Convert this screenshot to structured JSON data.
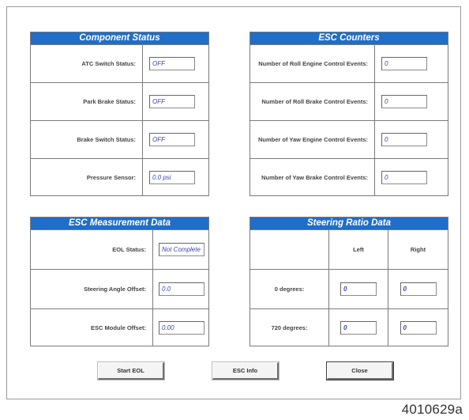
{
  "component_status": {
    "title": "Component Status",
    "rows": [
      {
        "label": "ATC Switch Status:",
        "value": "OFF"
      },
      {
        "label": "Park Brake Status:",
        "value": "OFF"
      },
      {
        "label": "Brake Switch Status:",
        "value": "OFF"
      },
      {
        "label": "Pressure Sensor:",
        "value": "0.0 psi"
      }
    ]
  },
  "esc_counters": {
    "title": "ESC Counters",
    "rows": [
      {
        "label": "Number of Roll Engine Control Events:",
        "value": "0"
      },
      {
        "label": "Number of Roll Brake Control Events:",
        "value": "0"
      },
      {
        "label": "Number of Yaw Engine Control Events:",
        "value": "0"
      },
      {
        "label": "Number of Yaw Brake Control Events:",
        "value": "0"
      }
    ]
  },
  "esc_measurement": {
    "title": "ESC Measurement Data",
    "rows": [
      {
        "label": "EOL Status:",
        "value": "Not Complete"
      },
      {
        "label": "Steering Angle Offset:",
        "value": "0.0"
      },
      {
        "label": "ESC Module Offset:",
        "value": "0.00"
      }
    ]
  },
  "steering_ratio": {
    "title": "Steering Ratio Data",
    "col_left": "Left",
    "col_right": "Right",
    "rows": [
      {
        "label": "0 degrees:",
        "left": "0",
        "right": "0"
      },
      {
        "label": "720 degrees:",
        "left": "0",
        "right": "0"
      }
    ]
  },
  "buttons": {
    "start_eol": "Start EOL",
    "esc_info": "ESC Info",
    "close": "Close"
  },
  "figure_id": "4010629a"
}
